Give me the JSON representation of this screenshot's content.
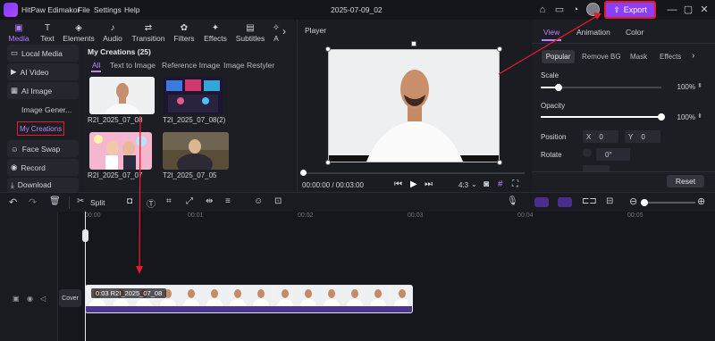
{
  "app": {
    "title": "HitPaw Edimakor",
    "menu": [
      "File",
      "Settings",
      "Help"
    ],
    "project_name": "2025-07-09_02",
    "export_label": "Export"
  },
  "toolbar": {
    "tools": [
      "Media",
      "Text",
      "Elements",
      "Audio",
      "Transition",
      "Filters",
      "Effects",
      "Subtitles",
      "A"
    ]
  },
  "leftnav": {
    "items": [
      "Local Media",
      "AI Video",
      "AI Image",
      "Face Swap",
      "Record",
      "Download"
    ],
    "sub_items": [
      "Image Gener...",
      "My Creations"
    ]
  },
  "media": {
    "header": "My Creations (25)",
    "tabs": [
      "All",
      "Text to Image",
      "Reference Image",
      "Image Restyler"
    ],
    "items": [
      {
        "label": "R2I_2025_07_08"
      },
      {
        "label": "T2I_2025_07_08(2)"
      },
      {
        "label": "R2I_2025_07_07"
      },
      {
        "label": "T2I_2025_07_05"
      }
    ]
  },
  "player": {
    "title": "Player",
    "time": "00:00:00 / 00:03:00",
    "ratio": "4:3"
  },
  "properties": {
    "tabs": [
      "View",
      "Animation",
      "Color"
    ],
    "subtabs": [
      "Popular",
      "Remove BG",
      "Mask",
      "Effects"
    ],
    "scale_label": "Scale",
    "scale_value": "100%",
    "scale": 0.15,
    "opacity_label": "Opacity",
    "opacity_value": "100%",
    "opacity": 1.0,
    "position_label": "Position",
    "pos_x_label": "X",
    "pos_x": "0",
    "pos_y_label": "Y",
    "pos_y": "0",
    "rotate_label": "Rotate",
    "rotate_value": "0°",
    "reset_label": "Reset"
  },
  "timeline": {
    "split_label": "Split",
    "ruler": [
      "00:00",
      "00:01",
      "00:02",
      "00:03",
      "00:04",
      "00:05"
    ],
    "cover_label": "Cover",
    "clip_label": "0:03  R2I_2025_07_08"
  },
  "colors": {
    "accent": "#8b3ff5",
    "highlight_box": "#e8192c",
    "clip_bar": "#4a3590"
  }
}
